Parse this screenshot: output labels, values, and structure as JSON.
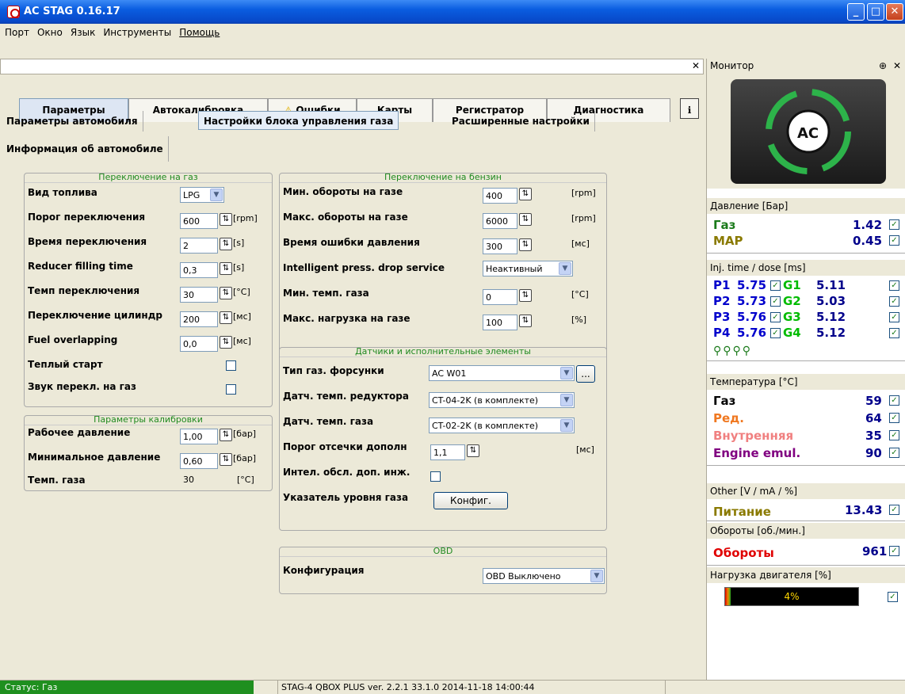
{
  "window": {
    "title": "AC STAG 0.16.17",
    "min": "_",
    "max": "□",
    "close": "✕"
  },
  "menu": [
    "Порт",
    "Окно",
    "Язык",
    "Инструменты",
    "Помощь"
  ],
  "tabs": {
    "t0": "Параметры",
    "t1": "Автокалибровка",
    "t2": "Ошибки",
    "t2_icon": "warning-icon",
    "t3": "Карты",
    "t4": "Регистратор",
    "t5": "Диагностика"
  },
  "subtabs": {
    "s0": "Параметры автомобиля",
    "s1": "Настройки блока управления газа",
    "s2": "Расширенные настройки",
    "s3": "Информация об автомобиле"
  },
  "gas_switch": {
    "title": "Переключение на газ",
    "fuel_label": "Вид топлива",
    "fuel_value": "LPG",
    "threshold_label": "Порог переключения",
    "threshold_value": "600",
    "threshold_unit": "[rpm]",
    "time_label": "Время переключения",
    "time_value": "2",
    "time_unit": "[s]",
    "reducer_label": "Reducer filling time",
    "reducer_value": "0,3",
    "reducer_unit": "[s]",
    "temp_label": "Темп переключения",
    "temp_value": "30",
    "temp_unit": "[°C]",
    "cyl_label": "Переключение цилиндр",
    "cyl_value": "200",
    "cyl_unit": "[мс]",
    "overlap_label": "Fuel overlapping",
    "overlap_value": "0,0",
    "overlap_unit": "[мс]",
    "warm_label": "Теплый старт",
    "sound_label": "Звук перекл. на газ"
  },
  "calib": {
    "title": "Параметры калибровки",
    "work_label": "Рабочее давление",
    "work_value": "1,00",
    "work_unit": "[бар]",
    "min_label": "Минимальное давление",
    "min_value": "0,60",
    "min_unit": "[бар]",
    "gas_temp_label": "Темп. газа",
    "gas_temp_value": "30",
    "gas_temp_unit": "[°C]"
  },
  "petrol_switch": {
    "title": "Переключение на бензин",
    "minrpm_label": "Мин. обороты на газе",
    "minrpm_value": "400",
    "minrpm_unit": "[rpm]",
    "maxrpm_label": "Макс. обороты на газе",
    "maxrpm_value": "6000",
    "maxrpm_unit": "[rpm]",
    "err_label": "Время ошибки давления",
    "err_value": "300",
    "err_unit": "[мс]",
    "intel_label": "Intelligent press. drop service",
    "intel_value": "Неактивный",
    "mintemp_label": "Мин. темп. газа",
    "mintemp_value": "0",
    "mintemp_unit": "[°C]",
    "maxload_label": "Макс. нагрузка на газе",
    "maxload_value": "100",
    "maxload_unit": "[%]"
  },
  "sensors": {
    "title": "Датчики и исполнительные элементы",
    "inj_label": "Тип газ. форсунки",
    "inj_value": "AC W01",
    "inj_more": "...",
    "red_label": "Датч. темп. редуктора",
    "red_value": "CT-04-2K (в комплекте)",
    "gas_label": "Датч. темп. газа",
    "gas_value": "CT-02-2K (в комплекте)",
    "cut_label": "Порог отсечки дополн",
    "cut_value": "1,1",
    "cut_unit": "[мс]",
    "intel_inj_label": "Интел. обсл. доп. инж.",
    "level_label": "Указатель уровня газа",
    "config_btn": "Конфиг."
  },
  "obd": {
    "title": "OBD",
    "config_label": "Конфигурация",
    "config_value": "OBD Выключено"
  },
  "monitor": {
    "title": "Монитор",
    "pin": "⊕",
    "close": "✕",
    "pressure_head": "Давление [Бар]",
    "gas_label": "Газ",
    "gas_value": "1.42",
    "map_label": "MAP",
    "map_value": "0.45",
    "inj_head": "Inj. time / dose [ms]",
    "inj": [
      {
        "p": "P1",
        "pv": "5.75",
        "g": "G1",
        "gv": "5.11"
      },
      {
        "p": "P2",
        "pv": "5.73",
        "g": "G2",
        "gv": "5.03"
      },
      {
        "p": "P3",
        "pv": "5.76",
        "g": "G3",
        "gv": "5.12"
      },
      {
        "p": "P4",
        "pv": "5.76",
        "g": "G4",
        "gv": "5.12"
      }
    ],
    "temp_head": "Температура [°C]",
    "t_gas_label": "Газ",
    "t_gas_value": "59",
    "t_red_label": "Ред.",
    "t_red_value": "64",
    "t_int_label": "Внутренняя",
    "t_int_value": "35",
    "t_emul_label": "Engine emul.",
    "t_emul_value": "90",
    "other_head": "Other [V / mA / %]",
    "power_label": "Питание",
    "power_value": "13.43",
    "rpm_head": "Обороты [об./мин.]",
    "rpm_label": "Обороты",
    "rpm_value": "961",
    "load_head": "Нагрузка двигателя [%]",
    "load_value": "4%",
    "load_fraction": 0.04
  },
  "status": {
    "left": "Статус: Газ",
    "right": "STAG-4 QBOX PLUS ver. 2.2.1 33.1.0 2014-11-18 14:00:44"
  },
  "colors": {
    "gas_green": "#1a7a1a",
    "map_olive": "#8a7a00",
    "red_orange": "#f07820",
    "internal_pink": "#f08080",
    "emul_purple": "#800080",
    "rpm_red": "#e00000",
    "inj_blue": "#0000cc",
    "g_green": "#00bb00"
  }
}
